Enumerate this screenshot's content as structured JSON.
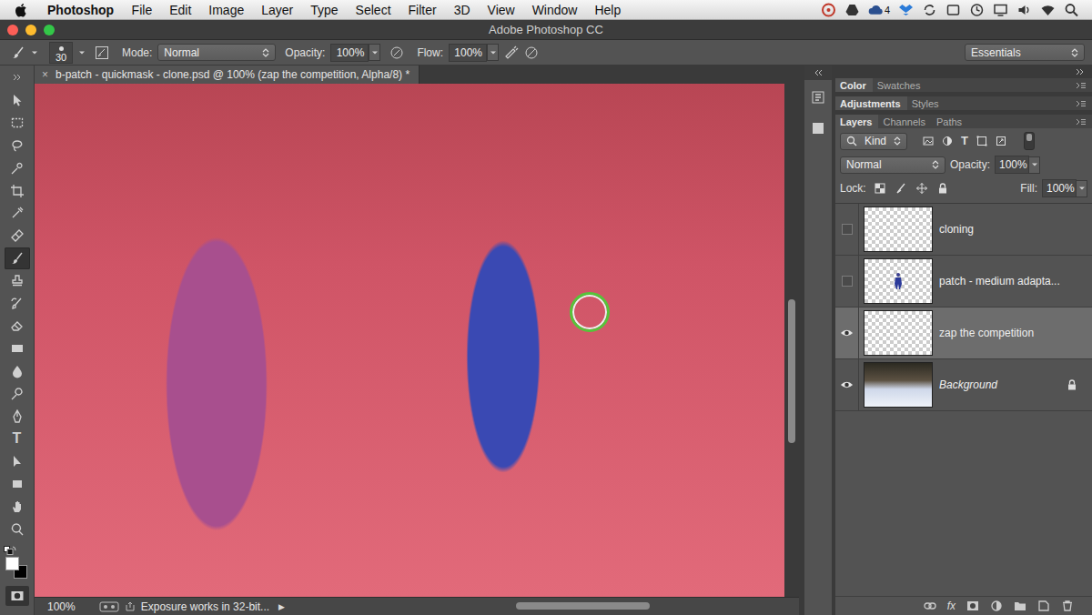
{
  "menubar": {
    "app": "Photoshop",
    "items": [
      "File",
      "Edit",
      "Image",
      "Layer",
      "Type",
      "Select",
      "Filter",
      "3D",
      "View",
      "Window",
      "Help"
    ],
    "cloud_badge": "4"
  },
  "window": {
    "title": "Adobe Photoshop CC"
  },
  "options_bar": {
    "brush_size": "30",
    "mode_label": "Mode:",
    "mode": "Normal",
    "opacity_label": "Opacity:",
    "opacity": "100%",
    "flow_label": "Flow:",
    "flow": "100%",
    "workspace": "Essentials"
  },
  "tools": [
    {
      "kind": "move",
      "selected": false
    },
    {
      "kind": "marquee",
      "selected": false
    },
    {
      "kind": "lasso",
      "selected": false
    },
    {
      "kind": "quickselect",
      "selected": false
    },
    {
      "kind": "crop",
      "selected": false
    },
    {
      "kind": "eyedropper",
      "selected": false
    },
    {
      "kind": "heal",
      "selected": false
    },
    {
      "kind": "brush",
      "selected": true
    },
    {
      "kind": "stamp",
      "selected": false
    },
    {
      "kind": "history",
      "selected": false
    },
    {
      "kind": "eraser",
      "selected": false
    },
    {
      "kind": "gradient",
      "selected": false
    },
    {
      "kind": "blur",
      "selected": false
    },
    {
      "kind": "dodge",
      "selected": false
    },
    {
      "kind": "pen",
      "selected": false
    },
    {
      "kind": "type",
      "glyph": "T",
      "selected": false
    },
    {
      "kind": "pathselect",
      "selected": false
    },
    {
      "kind": "shape",
      "selected": false
    },
    {
      "kind": "hand",
      "selected": false
    },
    {
      "kind": "zoom",
      "selected": false
    }
  ],
  "swatches": {
    "foreground": "#ffffff",
    "background": "#000000"
  },
  "quick_mask": {
    "on": true
  },
  "document": {
    "close": "×",
    "tab": "b-patch - quickmask - clone.psd @ 100% (zap the competition, Alpha/8) *"
  },
  "scrollbars": {
    "vertical": {
      "start": 0.42,
      "level": 0.28
    },
    "horizontal": {
      "start": 0.44,
      "level": 0.28
    }
  },
  "status_bar": {
    "zoom": "100%",
    "info": "Exposure works in 32-bit...",
    "arrow": "▶"
  },
  "panel_groups": [
    {
      "tabs": [
        {
          "label": "Color",
          "selected": true
        },
        {
          "label": "Swatches",
          "selected": false
        }
      ]
    },
    {
      "tabs": [
        {
          "label": "Adjustments",
          "selected": true
        },
        {
          "label": "Styles",
          "selected": false
        }
      ]
    }
  ],
  "layers_panel": {
    "tabs": [
      {
        "label": "Layers",
        "selected": true
      },
      {
        "label": "Channels",
        "selected": false
      },
      {
        "label": "Paths",
        "selected": false
      }
    ],
    "filter": "Kind",
    "type_filter_glyph": "T",
    "blend_mode": "Normal",
    "opacity_label": "Opacity:",
    "opacity": "100%",
    "lock_label": "Lock:",
    "fill_label": "Fill:",
    "fill": "100%",
    "fx": "fx",
    "layers": [
      {
        "name": "cloning",
        "visible": false,
        "selected": false,
        "locked": false,
        "italic": false,
        "thumbnail": "transparent"
      },
      {
        "name": "patch - medium adapta...",
        "visible": false,
        "selected": false,
        "locked": false,
        "italic": false,
        "thumbnail": "figure"
      },
      {
        "name": "zap the competition",
        "visible": true,
        "selected": true,
        "locked": false,
        "italic": false,
        "thumbnail": "transparent"
      },
      {
        "name": "Background",
        "visible": true,
        "selected": false,
        "locked": true,
        "italic": true,
        "thumbnail": "photo"
      }
    ]
  }
}
